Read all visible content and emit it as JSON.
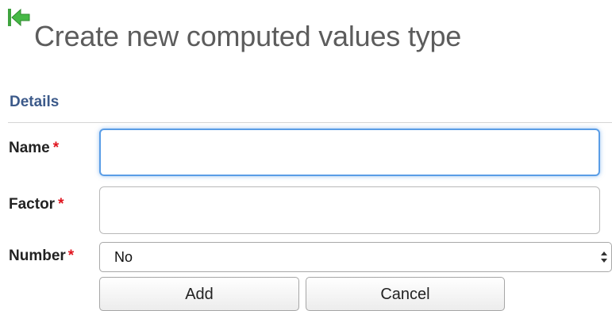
{
  "header": {
    "back_icon": "green-back-arrow-icon",
    "title": "Create new computed values type"
  },
  "section": {
    "title": "Details"
  },
  "form": {
    "required_marker": "*",
    "name": {
      "label": "Name",
      "value": ""
    },
    "factor": {
      "label": "Factor",
      "value": ""
    },
    "number": {
      "label": "Number",
      "selected": "No"
    }
  },
  "actions": {
    "add_label": "Add",
    "cancel_label": "Cancel"
  },
  "colors": {
    "title_text": "#5c5c5c",
    "section_title": "#3c5a8a",
    "required": "#e0141e",
    "focus_ring": "#5a9de6",
    "back_icon": "#3fb33f"
  }
}
